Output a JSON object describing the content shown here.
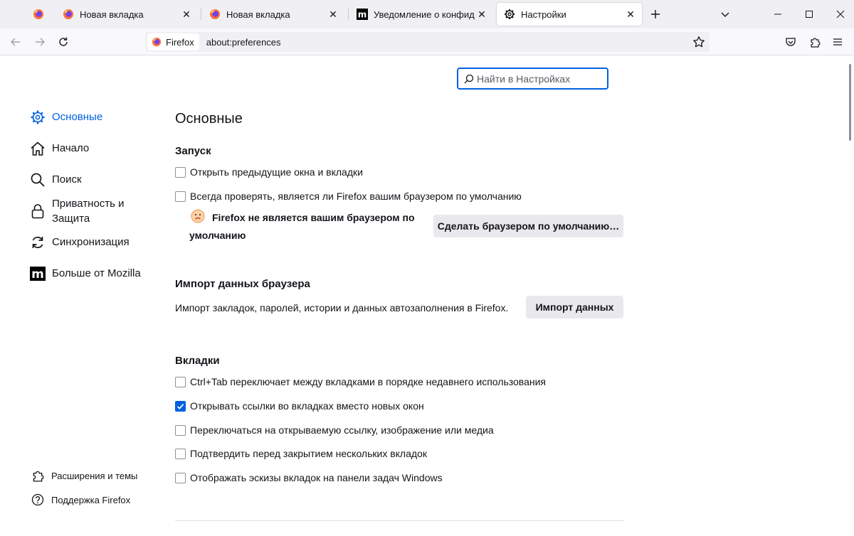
{
  "tabs": [
    {
      "title": ""
    },
    {
      "title": "Новая вкладка"
    },
    {
      "title": "Новая вкладка"
    },
    {
      "title": "Уведомление о конфиденциа"
    },
    {
      "title": "Настройки"
    }
  ],
  "urlbar": {
    "identity_label": "Firefox",
    "url": "about:preferences"
  },
  "search": {
    "placeholder": "Найти в Настройках"
  },
  "sidebar": {
    "items": [
      {
        "label": "Основные",
        "icon": "gear-icon"
      },
      {
        "label": "Начало",
        "icon": "home-icon"
      },
      {
        "label": "Поиск",
        "icon": "search-icon"
      },
      {
        "label": "Приватность и Защита",
        "icon": "lock-icon"
      },
      {
        "label": "Синхронизация",
        "icon": "sync-icon"
      },
      {
        "label": "Больше от Mozilla",
        "icon": "mozilla-icon"
      }
    ],
    "footer": [
      {
        "label": "Расширения и темы",
        "icon": "puzzle-icon"
      },
      {
        "label": "Поддержка Firefox",
        "icon": "help-icon"
      }
    ]
  },
  "main": {
    "title": "Основные",
    "startup": {
      "heading": "Запуск",
      "restore_label": "Открыть предыдущие окна и вкладки",
      "restore_checked": false,
      "default_check_label": "Всегда проверять, является ли Firefox вашим браузером по умолчанию",
      "default_check_checked": false,
      "not_default_text": "Firefox не является вашим браузером по умолчанию",
      "make_default_button": "Сделать браузером по умолчанию…"
    },
    "import": {
      "heading": "Импорт данных браузера",
      "description": "Импорт закладок, паролей, истории и данных автозаполнения в Firefox.",
      "button": "Импорт данных"
    },
    "tabs": {
      "heading": "Вкладки",
      "options": [
        {
          "label": "Ctrl+Tab переключает между вкладками в порядке недавнего использования",
          "checked": false
        },
        {
          "label": "Открывать ссылки во вкладках вместо новых окон",
          "checked": true
        },
        {
          "label": "Переключаться на открываемую ссылку, изображение или медиа",
          "checked": false
        },
        {
          "label": "Подтвердить перед закрытием нескольких вкладок",
          "checked": false
        },
        {
          "label": "Отображать эскизы вкладок на панели задач Windows",
          "checked": false
        }
      ]
    }
  },
  "colors": {
    "accent": "#0061e0",
    "text": "#15141a",
    "button_bg": "#e9e9ed"
  }
}
